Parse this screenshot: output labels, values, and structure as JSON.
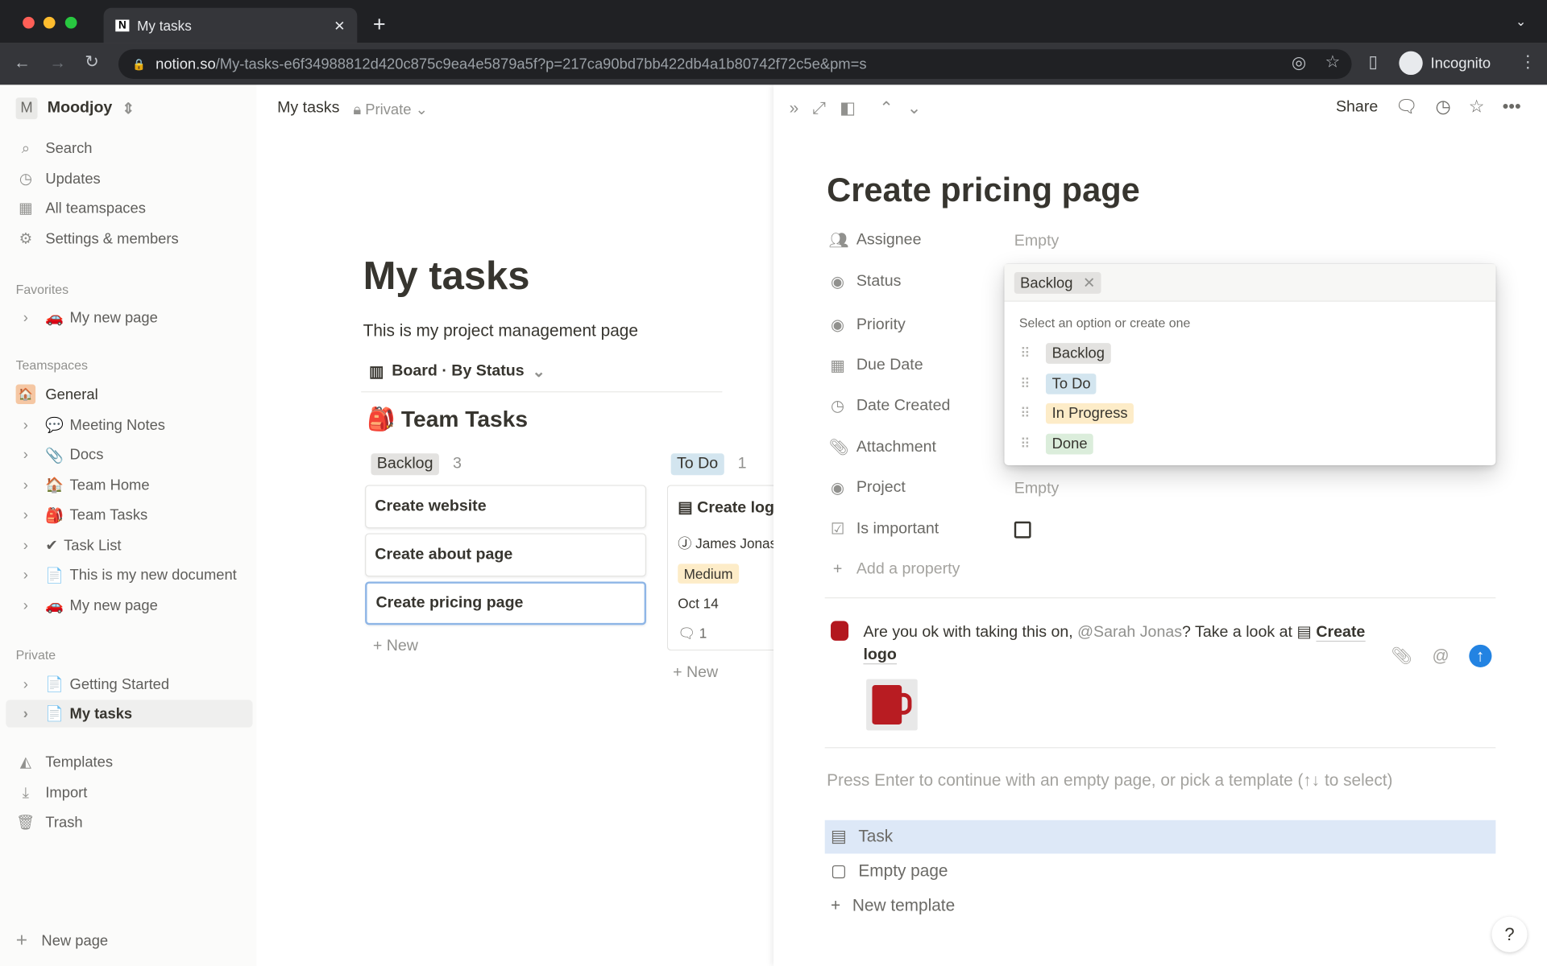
{
  "browser": {
    "tab_title": "My tasks",
    "url_host": "notion.so",
    "url_path": "/My-tasks-e6f34988812d420c875c9ea4e5879a5f?p=217ca90bd7bb422db4a1b80742f72c5e&pm=s",
    "profile": "Incognito"
  },
  "sidebar": {
    "workspace": "Moodjoy",
    "workspace_initial": "M",
    "top": [
      {
        "label": "Search",
        "icon": "search-icon"
      },
      {
        "label": "Updates",
        "icon": "clock-icon"
      },
      {
        "label": "All teamspaces",
        "icon": "building-icon"
      },
      {
        "label": "Settings & members",
        "icon": "gear-icon"
      }
    ],
    "favorites_heading": "Favorites",
    "favorites": [
      {
        "label": "My new page",
        "emoji": "🚗"
      }
    ],
    "teamspaces_heading": "Teamspaces",
    "teamspace_name": "General",
    "teamspaces": [
      {
        "label": "Meeting Notes",
        "emoji": "💬"
      },
      {
        "label": "Docs",
        "emoji": "📎"
      },
      {
        "label": "Team Home",
        "emoji": "🏠"
      },
      {
        "label": "Team Tasks",
        "emoji": "🎒"
      },
      {
        "label": "Task List",
        "emoji": "✔"
      },
      {
        "label": "This is my new document",
        "emoji": "📄"
      },
      {
        "label": "My new page",
        "emoji": "🚗"
      }
    ],
    "private_heading": "Private",
    "private": [
      {
        "label": "Getting Started",
        "emoji": "📄"
      },
      {
        "label": "My tasks",
        "emoji": "📄"
      }
    ],
    "bottom": [
      {
        "label": "Templates"
      },
      {
        "label": "Import"
      },
      {
        "label": "Trash"
      }
    ],
    "new_page": "New page"
  },
  "topbar": {
    "breadcrumb": "My tasks",
    "privacy": "Private"
  },
  "page": {
    "title": "My tasks",
    "description": "This is my project management page",
    "view": "Board · By Status",
    "db_title": "Team Tasks",
    "columns": [
      {
        "name": "Backlog",
        "count": "3",
        "color": "#e3e2e0",
        "cards": [
          "Create website",
          "Create about page",
          "Create pricing page"
        ]
      },
      {
        "name": "To Do",
        "count": "1",
        "color": "#d3e5ef"
      }
    ],
    "todo_card": {
      "title": "Create logo",
      "assignee": "James Jonas",
      "priority": "Medium",
      "date": "Oct 14",
      "comments": "1"
    },
    "new_label": "New"
  },
  "peek": {
    "share": "Share",
    "title": "Create pricing page",
    "props": [
      {
        "name": "Assignee",
        "value": "Empty"
      },
      {
        "name": "Status",
        "value": ""
      },
      {
        "name": "Priority",
        "value": ""
      },
      {
        "name": "Due Date",
        "value": ""
      },
      {
        "name": "Date Created",
        "value": ""
      },
      {
        "name": "Attachment",
        "value": ""
      },
      {
        "name": "Project",
        "value": "Empty"
      },
      {
        "name": "Is important",
        "value": ""
      }
    ],
    "add_property": "Add a property",
    "comment": {
      "text1": "Are you ok with taking this on, ",
      "mention": "@Sarah Jonas",
      "text2": "? Take a look at ",
      "link": "Create logo"
    },
    "template_hint": "Press Enter to continue with an empty page, or pick a template (↑↓ to select)",
    "templates": [
      "Task",
      "Empty page",
      "New template"
    ]
  },
  "status_menu": {
    "selected": "Backlog",
    "hint": "Select an option or create one",
    "options": [
      {
        "label": "Backlog",
        "color": "#e3e2e0"
      },
      {
        "label": "To Do",
        "color": "#d3e5ef"
      },
      {
        "label": "In Progress",
        "color": "#fdecc8"
      },
      {
        "label": "Done",
        "color": "#dbeddb"
      }
    ]
  },
  "help": "?"
}
